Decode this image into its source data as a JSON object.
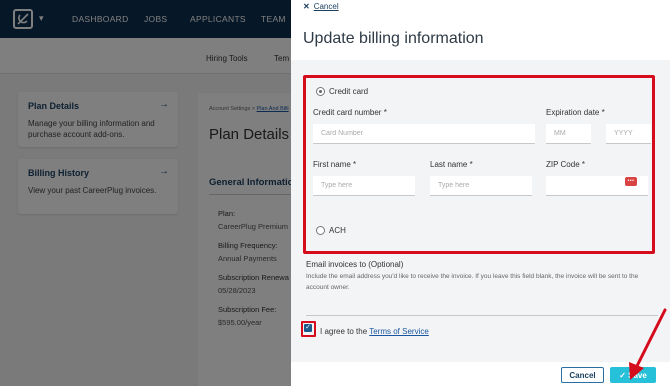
{
  "nav": {
    "items": [
      "DASHBOARD",
      "JOBS",
      "APPLICANTS",
      "TEAM"
    ]
  },
  "subnav": {
    "items": [
      "Hiring Tools",
      "Tem"
    ]
  },
  "sidebar": {
    "cards": [
      {
        "title": "Plan Details",
        "desc_line1": "Manage your billing information and",
        "desc_line2": "purchase account add-ons."
      },
      {
        "title": "Billing History",
        "desc_line1": "View your past CareerPlug invoices.",
        "desc_line2": ""
      }
    ]
  },
  "main": {
    "breadcrumb_base": "Account Settings >",
    "breadcrumb_link": "Plan And Billi",
    "title": "Plan Details",
    "section": "General Informatio",
    "details": [
      {
        "label": "Plan:",
        "value": "CareerPlug Premium"
      },
      {
        "label": "Billing Frequency:",
        "value": "Annual Payments"
      },
      {
        "label": "Subscription Renewa",
        "value": "05/28/2023"
      },
      {
        "label": "Subscription Fee:",
        "value": "$595.00/year"
      }
    ]
  },
  "modal": {
    "close_label": "Cancel",
    "close_symbol": "✕",
    "title": "Update billing information",
    "payment": {
      "credit_card_label": "Credit card",
      "ach_label": "ACH",
      "selected": "Credit card"
    },
    "fields": {
      "card_number": {
        "label": "Credit card number *",
        "placeholder": "Card Number"
      },
      "expiration": {
        "label": "Expiration date *",
        "mm_placeholder": "MM",
        "yyyy_placeholder": "YYYY"
      },
      "first_name": {
        "label": "First name *",
        "placeholder": "Type here"
      },
      "last_name": {
        "label": "Last name *",
        "placeholder": "Type here"
      },
      "zip": {
        "label": "ZIP Code *",
        "placeholder": ""
      }
    },
    "email": {
      "label": "Email invoices to (Optional)",
      "help": "Include the email address you'd like to receive the invoice. If you leave this field blank, the invoice will be sent to the account owner."
    },
    "agree": {
      "checked": true,
      "text": "I agree to the",
      "link": "Terms of Service"
    },
    "footer": {
      "cancel_label": "Cancel",
      "save_label": "Save",
      "save_icon": "✓"
    }
  },
  "colors": {
    "nav_bg": "#0d2e4e",
    "highlight_red": "#d40c1c",
    "save_button": "#26c0d9"
  }
}
